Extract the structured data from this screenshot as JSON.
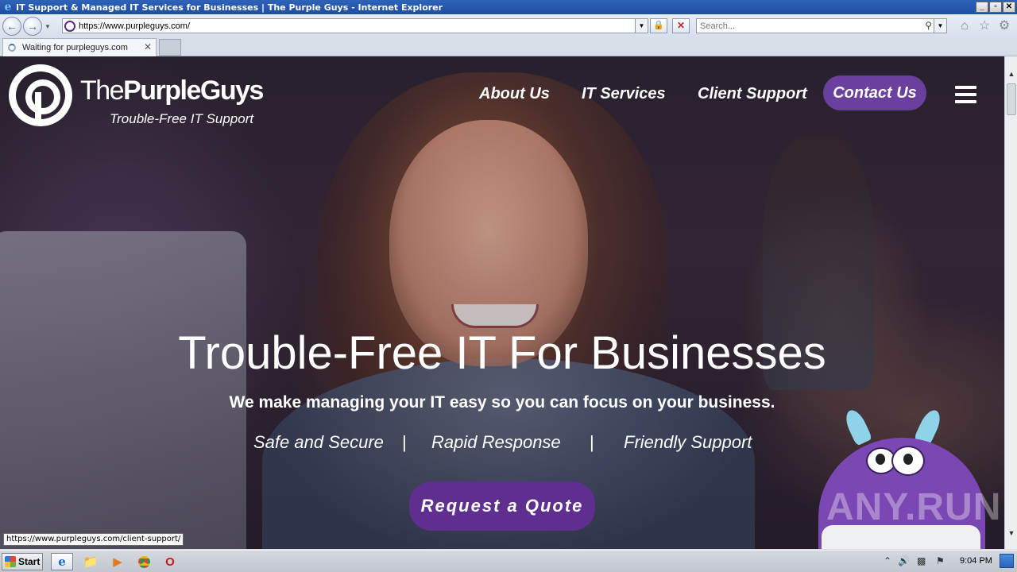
{
  "window": {
    "title": "IT Support & Managed IT Services for Businesses | The Purple Guys - Internet Explorer",
    "controls": [
      "_",
      "▫",
      "✕"
    ]
  },
  "browser": {
    "address": "https://www.purpleguys.com/",
    "search_placeholder": "Search...",
    "tab_label": "Waiting for purpleguys.com",
    "status_url": "https://www.purpleguys.com/client-support/"
  },
  "site": {
    "brand_light": "The",
    "brand_bold": "PurpleGuys",
    "tagline": "Trouble-Free IT Support",
    "nav": {
      "about": "About Us",
      "services": "IT Services",
      "support": "Client Support",
      "contact": "Contact Us"
    },
    "hero": {
      "title": "Trouble-Free IT For Businesses",
      "subtitle": "We make managing your IT easy so you can focus on your business.",
      "features": [
        "Safe and Secure",
        "Rapid Response",
        "Friendly Support"
      ],
      "separator": "|",
      "cta": "Request a Quote"
    },
    "accent_color": "#6a3f9e"
  },
  "watermark": "ANY.RUN",
  "taskbar": {
    "start_label": "Start",
    "clock": "9:04 PM"
  }
}
